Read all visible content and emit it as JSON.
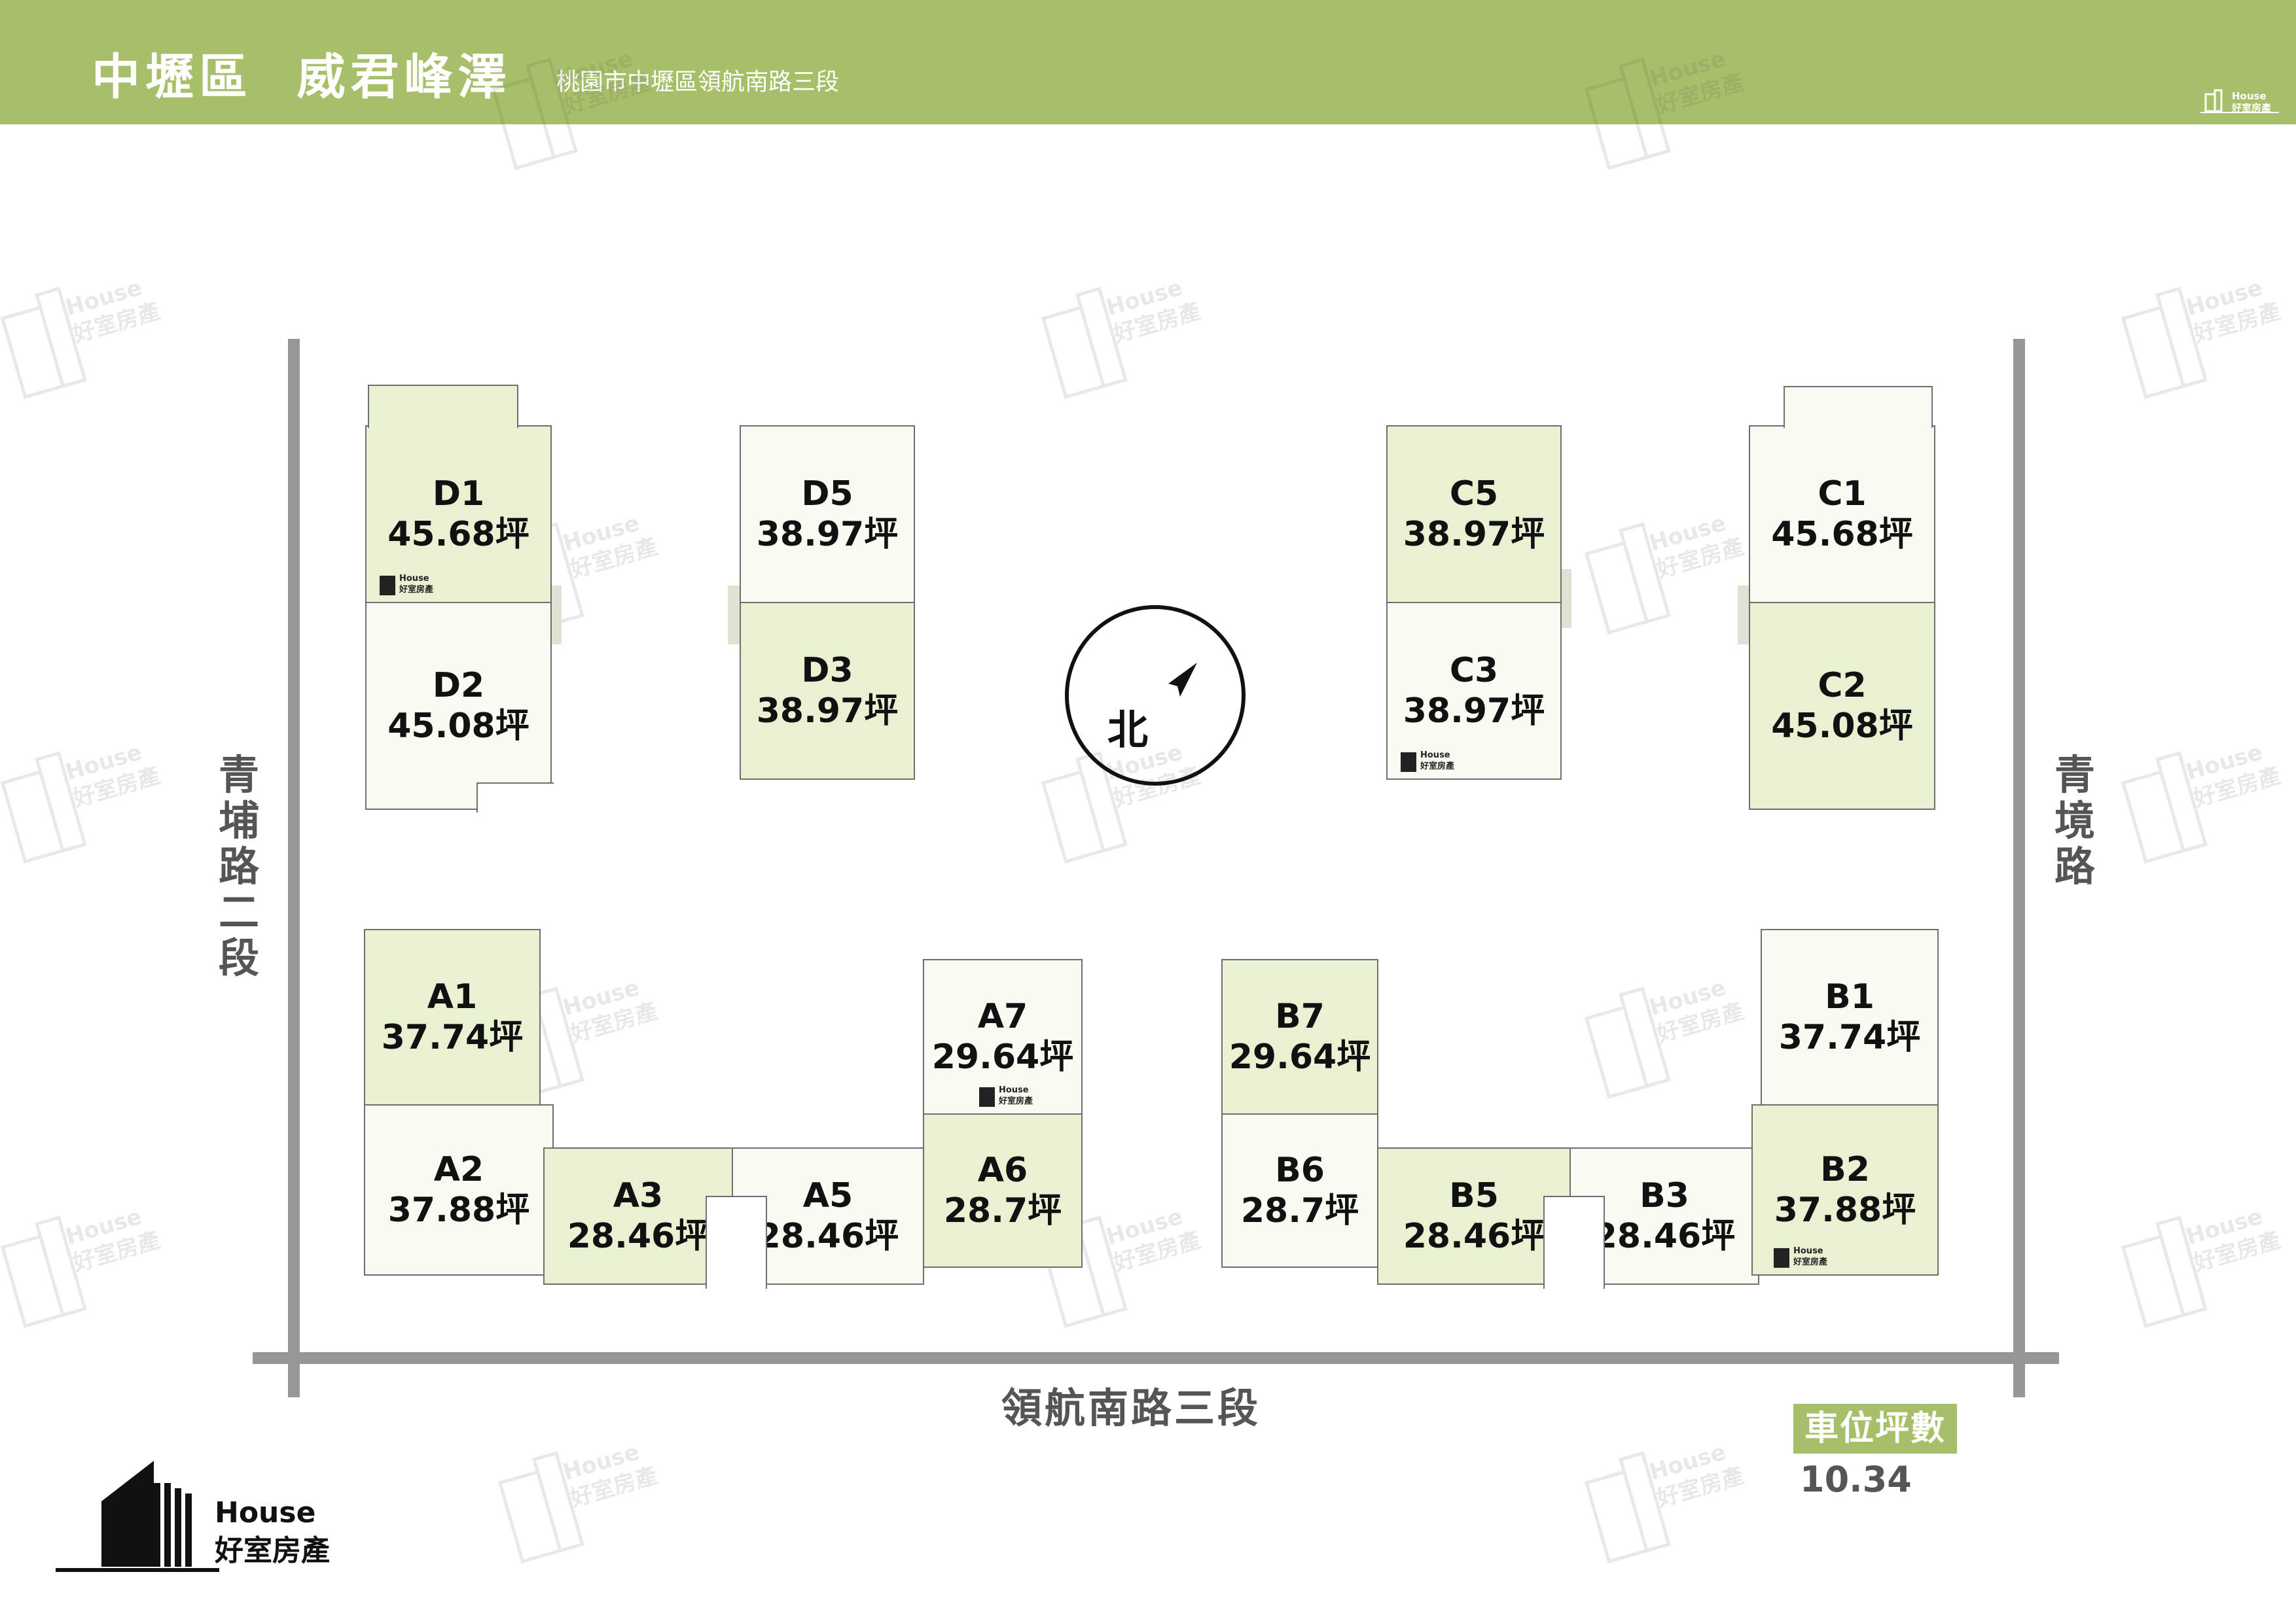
{
  "header": {
    "district": "中壢區",
    "project": "威君峰澤",
    "address": "桃園市中壢區領航南路三段"
  },
  "brand": {
    "name_en": "House",
    "name_zh": "好室房產"
  },
  "roads": {
    "left": "青埔路二段",
    "right": "青境路",
    "bottom": "領航南路三段"
  },
  "compass_label": "北",
  "units": {
    "D1": {
      "name": "D1",
      "area": "45.68坪"
    },
    "D2": {
      "name": "D2",
      "area": "45.08坪"
    },
    "D5": {
      "name": "D5",
      "area": "38.97坪"
    },
    "D3": {
      "name": "D3",
      "area": "38.97坪"
    },
    "C5": {
      "name": "C5",
      "area": "38.97坪"
    },
    "C3": {
      "name": "C3",
      "area": "38.97坪"
    },
    "C1": {
      "name": "C1",
      "area": "45.68坪"
    },
    "C2": {
      "name": "C2",
      "area": "45.08坪"
    },
    "A1": {
      "name": "A1",
      "area": "37.74坪"
    },
    "A2": {
      "name": "A2",
      "area": "37.88坪"
    },
    "A3": {
      "name": "A3",
      "area": "28.46坪"
    },
    "A5": {
      "name": "A5",
      "area": "28.46坪"
    },
    "A6": {
      "name": "A6",
      "area": "28.7坪"
    },
    "A7": {
      "name": "A7",
      "area": "29.64坪"
    },
    "B7": {
      "name": "B7",
      "area": "29.64坪"
    },
    "B6": {
      "name": "B6",
      "area": "28.7坪"
    },
    "B5": {
      "name": "B5",
      "area": "28.46坪"
    },
    "B3": {
      "name": "B3",
      "area": "28.46坪"
    },
    "B1": {
      "name": "B1",
      "area": "37.74坪"
    },
    "B2": {
      "name": "B2",
      "area": "37.88坪"
    }
  },
  "parking": {
    "label": "車位坪數",
    "value": "10.34"
  },
  "colors": {
    "accent": "#a7bf69",
    "unit_green": "#e8f2d3",
    "unit_white": "#f8fbf1",
    "road": "#969696"
  }
}
